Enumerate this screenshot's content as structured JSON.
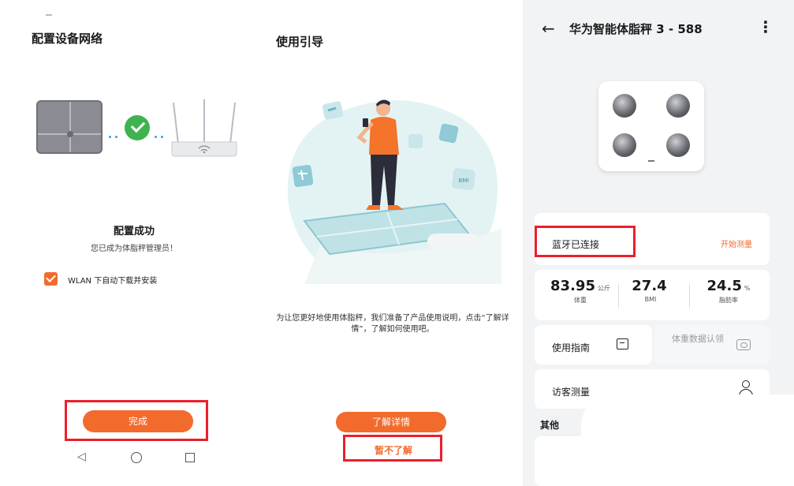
{
  "panel1": {
    "title": "配置设备网络",
    "success_title": "配置成功",
    "success_subtitle": "您已成为体脂秤管理员！",
    "auto_download_label": "WLAN 下自动下载并安装",
    "auto_download_checked": true,
    "done_button": "完成",
    "nav": {
      "back": "◁",
      "home": "",
      "recent": ""
    }
  },
  "panel2": {
    "title": "使用引导",
    "description": "为让您更好地使用体脂秤，我们准备了产品使用说明，点击“了解详情”，了解如何使用吧。",
    "learn_more_button": "了解详情",
    "not_now_link": "暂不了解",
    "illustration_badge": "BMI"
  },
  "panel3": {
    "back_icon": "←",
    "title": "华为智能体脂秤 3 - 588",
    "more_icon": "⋮",
    "bluetooth_status": "蓝牙已连接",
    "start_measure": "开始测量",
    "stats": [
      {
        "value": "83.95",
        "unit": "公斤",
        "label": "体重"
      },
      {
        "value": "27.4",
        "unit": "",
        "label": "BMI"
      },
      {
        "value": "24.5",
        "unit": "%",
        "label": "脂肪率"
      }
    ],
    "guide_label": "使用指南",
    "claim_label": "体重数据认领",
    "visitor_label": "访客测量",
    "other_title": "其他"
  },
  "colors": {
    "accent": "#f26b2d",
    "highlight_box": "#ec1f2b",
    "success_green": "#3fb34f"
  }
}
